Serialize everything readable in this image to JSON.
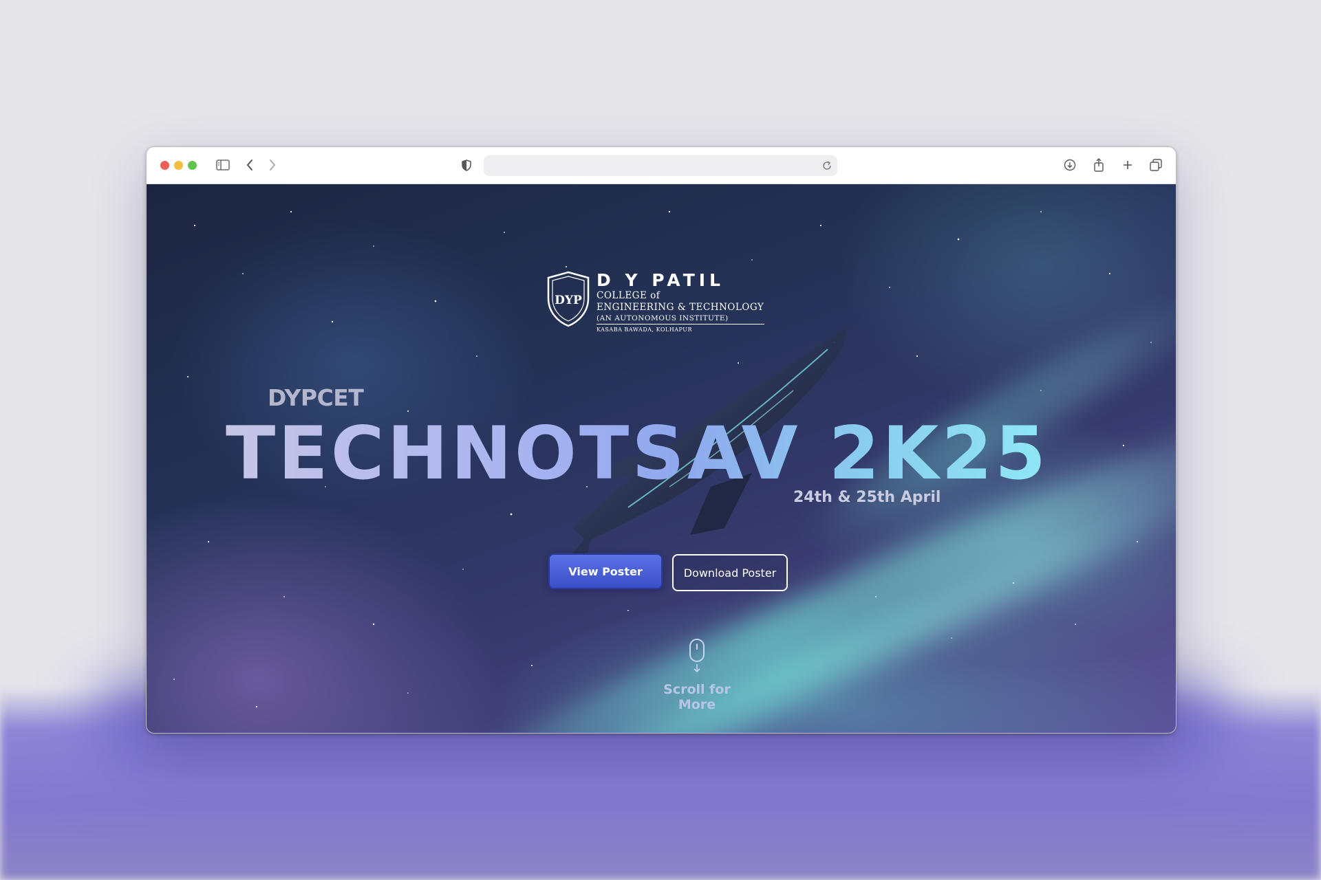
{
  "browser": {
    "address_value": "",
    "icons": [
      "sidebar-icon",
      "back-icon",
      "forward-icon",
      "shield-icon",
      "reload-icon",
      "download-icon",
      "share-icon",
      "new-tab-icon",
      "tabs-overview-icon"
    ]
  },
  "hero": {
    "logo": {
      "title": "D Y PATIL",
      "line1": "COLLEGE of",
      "line2": "ENGINEERING & TECHNOLOGY",
      "line3": "(AN AUTONOMOUS INSTITUTE)",
      "line4": "KASABA BAWADA, KOLHAPUR",
      "emblem_text": "DYP"
    },
    "eyebrow": "DYPCET",
    "title": "TECHNOTSAV 2K25",
    "date": "24th & 25th April",
    "buttons": {
      "view_poster": "View Poster",
      "download_poster": "Download Poster"
    },
    "scroll_label": "Scroll for More"
  },
  "colors": {
    "page_background": "#e6e5ea",
    "glow": "#7b73cf",
    "primary_button": "#3a4fc6",
    "headline_start": "#c6c6e6",
    "headline_end": "#8fe8f4"
  }
}
